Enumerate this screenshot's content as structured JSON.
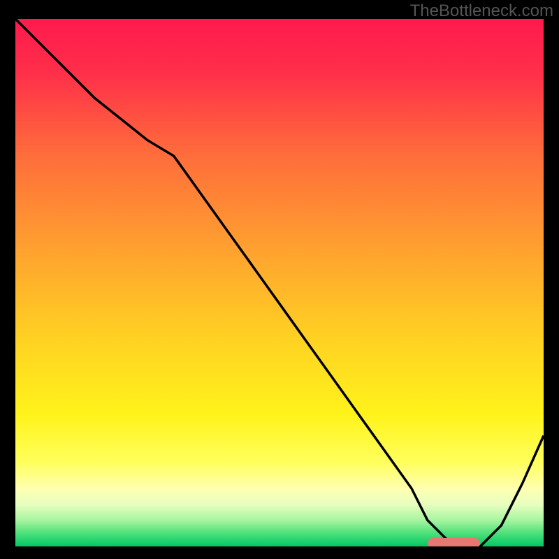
{
  "watermark": "TheBottleneck.com",
  "chart_data": {
    "type": "line",
    "title": "",
    "xlabel": "",
    "ylabel": "",
    "xlim": [
      0,
      100
    ],
    "ylim": [
      0,
      100
    ],
    "series": [
      {
        "name": "curve",
        "x": [
          0,
          5,
          10,
          15,
          20,
          25,
          30,
          35,
          40,
          45,
          50,
          55,
          60,
          65,
          70,
          75,
          78,
          82,
          85,
          88,
          92,
          96,
          100
        ],
        "y": [
          100,
          95,
          90,
          85,
          81,
          77,
          74,
          67,
          60,
          53,
          46,
          39,
          32,
          25,
          18,
          11,
          5,
          1,
          0,
          0,
          4,
          12,
          21
        ]
      }
    ],
    "marker": {
      "x_start": 78,
      "x_end": 88,
      "y": 0.5
    },
    "gradient_stops": [
      {
        "offset": 0.0,
        "color": "#ff1a4d"
      },
      {
        "offset": 0.1,
        "color": "#ff2e4a"
      },
      {
        "offset": 0.25,
        "color": "#ff6a3c"
      },
      {
        "offset": 0.45,
        "color": "#ffa52e"
      },
      {
        "offset": 0.6,
        "color": "#ffd023"
      },
      {
        "offset": 0.75,
        "color": "#fff31a"
      },
      {
        "offset": 0.84,
        "color": "#ffff5c"
      },
      {
        "offset": 0.89,
        "color": "#ffffb0"
      },
      {
        "offset": 0.92,
        "color": "#e8ffc0"
      },
      {
        "offset": 0.95,
        "color": "#a8f5a0"
      },
      {
        "offset": 0.975,
        "color": "#4ee07a"
      },
      {
        "offset": 1.0,
        "color": "#00c865"
      }
    ]
  }
}
